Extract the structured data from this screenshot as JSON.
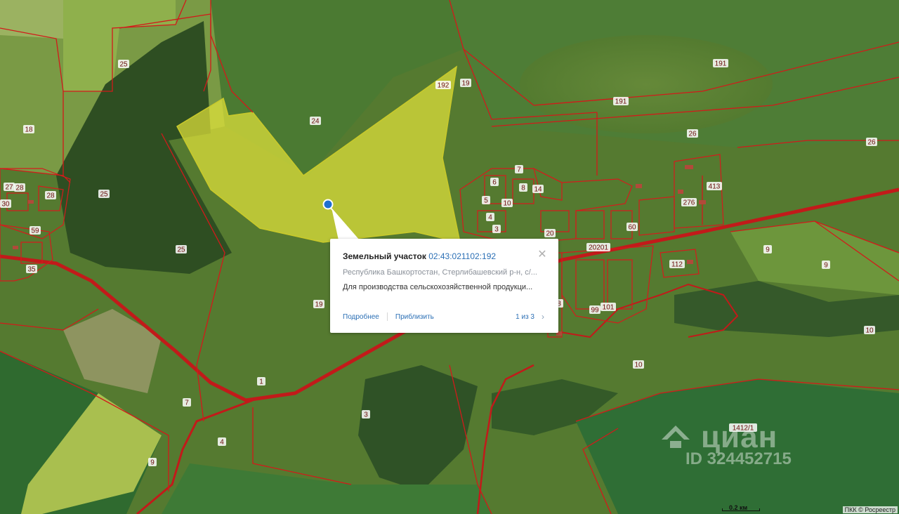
{
  "map": {
    "parcel_labels": [
      {
        "text": "25"
      },
      {
        "text": "18"
      },
      {
        "text": "24"
      },
      {
        "text": "19"
      },
      {
        "text": "192"
      },
      {
        "text": "191"
      },
      {
        "text": "191"
      },
      {
        "text": "26"
      },
      {
        "text": "26"
      },
      {
        "text": "25"
      },
      {
        "text": "25"
      },
      {
        "text": "28"
      },
      {
        "text": "27"
      },
      {
        "text": "28"
      },
      {
        "text": "59"
      },
      {
        "text": "35"
      },
      {
        "text": "30"
      },
      {
        "text": "7"
      },
      {
        "text": "6"
      },
      {
        "text": "8"
      },
      {
        "text": "14"
      },
      {
        "text": "5"
      },
      {
        "text": "10"
      },
      {
        "text": "4"
      },
      {
        "text": "3"
      },
      {
        "text": "20"
      },
      {
        "text": "20201"
      },
      {
        "text": "276"
      },
      {
        "text": "413"
      },
      {
        "text": "112"
      },
      {
        "text": "9"
      },
      {
        "text": "9"
      },
      {
        "text": "10"
      },
      {
        "text": "10"
      },
      {
        "text": "19"
      },
      {
        "text": "1"
      },
      {
        "text": "7"
      },
      {
        "text": "3"
      },
      {
        "text": "4"
      },
      {
        "text": "9"
      },
      {
        "text": "1412/1"
      },
      {
        "text": "101"
      },
      {
        "text": "99"
      },
      {
        "text": "60"
      },
      {
        "text": "8"
      }
    ],
    "colors": {
      "highlight": "#e6e63a",
      "boundary": "#d21a1a",
      "marker": "#1f6fd1"
    }
  },
  "popup": {
    "title": "Земельный участок",
    "cadastral_number": "02:43:021102:192",
    "address": "Республика Башкортостан, Стерлибашевский р-н, с/...",
    "purpose": "Для производства сельскохозяйственной продукци...",
    "details_label": "Подробнее",
    "zoom_label": "Приблизить",
    "pager": "1 из 3"
  },
  "scale": {
    "label": "0.2 км"
  },
  "attribution": "ПКК © Росреестр",
  "watermark": {
    "brand": "циан",
    "id_text": "ID 324452715"
  }
}
